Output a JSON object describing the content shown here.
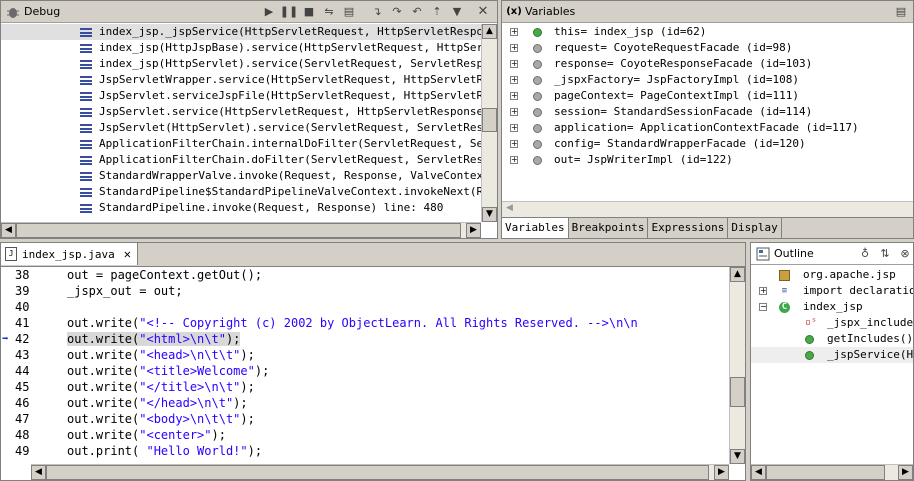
{
  "debug": {
    "title": "Debug",
    "toolbar_icons": [
      "resume-icon",
      "suspend-icon",
      "terminate-icon",
      "disconnect-icon",
      "remove-terminated-icon",
      "step-into-icon",
      "step-over-icon",
      "step-return-icon",
      "drop-to-frame-icon",
      "view-menu-icon"
    ],
    "frames": [
      "index_jsp._jspService(HttpServletRequest, HttpServletResponse) li",
      "index_jsp(HttpJspBase).service(HttpServletRequest, HttpServletR",
      "index_jsp(HttpServlet).service(ServletRequest, ServletResponse)",
      "JspServletWrapper.service(HttpServletRequest, HttpServletRespon",
      "JspServlet.serviceJspFile(HttpServletRequest, HttpServletRespon",
      "JspServlet.service(HttpServletRequest, HttpServletResponse) lin",
      "JspServlet(HttpServlet).service(ServletRequest, ServletResponse",
      "ApplicationFilterChain.internalDoFilter(ServletRequest, Servlet",
      "ApplicationFilterChain.doFilter(ServletRequest, ServletResponse",
      "StandardWrapperValve.invoke(Request, Response, ValveContext) li",
      "StandardPipeline$StandardPipelineValveContext.invokeNext(Reques",
      "StandardPipeline.invoke(Request, Response) line: 480"
    ],
    "selected_index": 0
  },
  "variables": {
    "title": "Variables",
    "rows": [
      {
        "text": "this= index_jsp  (id=62)",
        "icon": "green"
      },
      {
        "text": "request= CoyoteRequestFacade  (id=98)",
        "icon": "gray"
      },
      {
        "text": "response= CoyoteResponseFacade  (id=103)",
        "icon": "gray"
      },
      {
        "text": "_jspxFactory= JspFactoryImpl  (id=108)",
        "icon": "gray"
      },
      {
        "text": "pageContext= PageContextImpl  (id=111)",
        "icon": "gray"
      },
      {
        "text": "session= StandardSessionFacade  (id=114)",
        "icon": "gray"
      },
      {
        "text": "application= ApplicationContextFacade  (id=117)",
        "icon": "gray"
      },
      {
        "text": "config= StandardWrapperFacade  (id=120)",
        "icon": "gray"
      },
      {
        "text": "out= JspWriterImpl  (id=122)",
        "icon": "gray"
      }
    ],
    "tabs": [
      "Variables",
      "Breakpoints",
      "Expressions",
      "Display"
    ],
    "active_tab": 0
  },
  "editor": {
    "tab_label": "index_jsp.java",
    "current_line": 42,
    "lines": [
      {
        "num": "38",
        "pre": "out = pageContext.getOut();",
        "str": "",
        "post": ""
      },
      {
        "num": "39",
        "pre": "_jspx_out = out;",
        "str": "",
        "post": ""
      },
      {
        "num": "40",
        "pre": "",
        "str": "",
        "post": ""
      },
      {
        "num": "41",
        "pre": "out.write(",
        "str": "\"<!-- Copyright (c) 2002 by ObjectLearn. All Rights Reserved. -->\\n\\n",
        "post": ""
      },
      {
        "num": "42",
        "pre": "out.write(",
        "str": "\"<html>\\n\\t\"",
        "post": ");"
      },
      {
        "num": "43",
        "pre": "out.write(",
        "str": "\"<head>\\n\\t\\t\"",
        "post": ");"
      },
      {
        "num": "44",
        "pre": "out.write(",
        "str": "\"<title>Welcome\"",
        "post": ");"
      },
      {
        "num": "45",
        "pre": "out.write(",
        "str": "\"</title>\\n\\t\"",
        "post": ");"
      },
      {
        "num": "46",
        "pre": "out.write(",
        "str": "\"</head>\\n\\t\"",
        "post": ");"
      },
      {
        "num": "47",
        "pre": "out.write(",
        "str": "\"<body>\\n\\t\\t\"",
        "post": ");"
      },
      {
        "num": "48",
        "pre": "out.write(",
        "str": "\"<center>\"",
        "post": ");"
      },
      {
        "num": "49",
        "pre": "out.print( ",
        "str": "\"Hello World!\"",
        "post": ");"
      }
    ]
  },
  "outline": {
    "title": "Outline",
    "toolbar_icons": [
      "hide-fields-icon",
      "sort-icon",
      "hide-static-icon"
    ],
    "items": [
      {
        "label": "org.apache.jsp",
        "icon": "package-icon",
        "indent": 0,
        "expander": ""
      },
      {
        "label": "import declarations",
        "icon": "imports-icon",
        "indent": 0,
        "expander": "+"
      },
      {
        "label": "index_jsp",
        "icon": "class-icon",
        "indent": 0,
        "expander": "-"
      },
      {
        "label": "_jspx_includes",
        "icon": "private-static-field-icon",
        "indent": 1,
        "expander": ""
      },
      {
        "label": "getIncludes()",
        "icon": "public-method-icon",
        "indent": 1,
        "expander": ""
      },
      {
        "label": "_jspService(Htt",
        "icon": "public-method-icon",
        "indent": 1,
        "expander": ""
      }
    ]
  }
}
